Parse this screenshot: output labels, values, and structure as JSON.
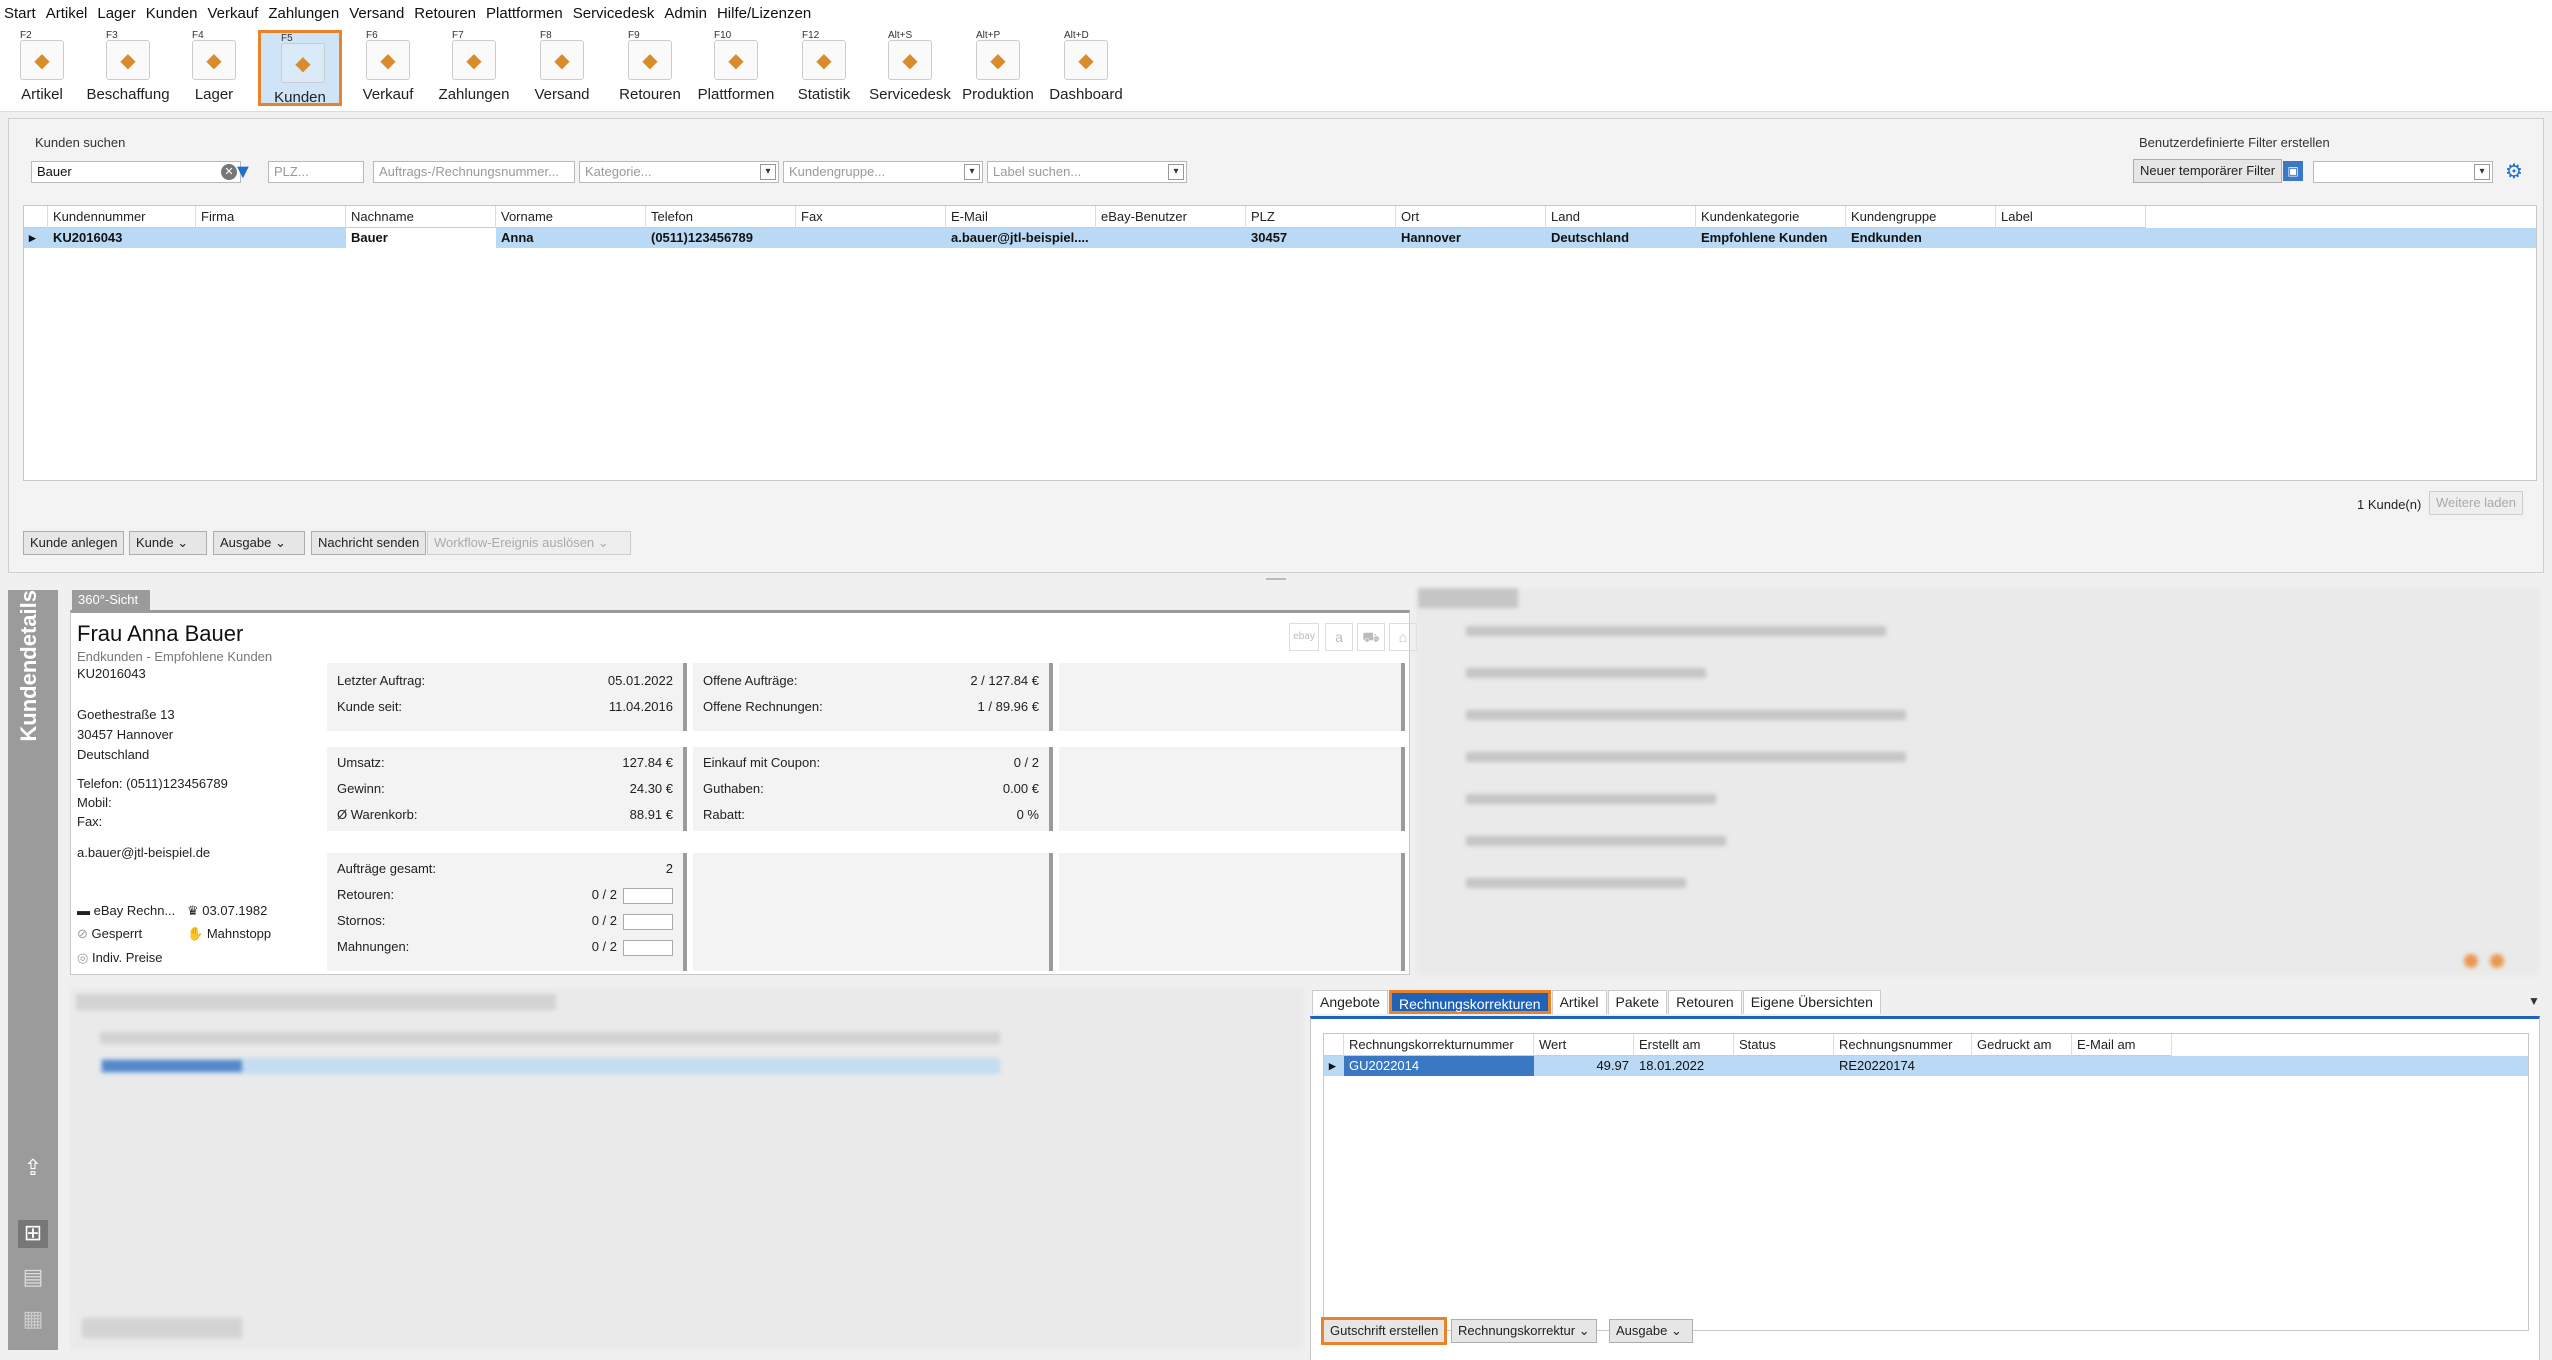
{
  "menu": [
    "Start",
    "Artikel",
    "Lager",
    "Kunden",
    "Verkauf",
    "Zahlungen",
    "Versand",
    "Retouren",
    "Plattformen",
    "Servicedesk",
    "Admin",
    "Hilfe/Lizenzen"
  ],
  "ribbon": [
    {
      "key": "F2",
      "label": "Artikel",
      "icon": "tag-icon"
    },
    {
      "key": "F3",
      "label": "Beschaffung",
      "icon": "box-star-icon"
    },
    {
      "key": "F4",
      "label": "Lager",
      "icon": "warehouse-icon"
    },
    {
      "key": "F5",
      "label": "Kunden",
      "icon": "customer-icon",
      "active": true
    },
    {
      "key": "F6",
      "label": "Verkauf",
      "icon": "cart-icon"
    },
    {
      "key": "F7",
      "label": "Zahlungen",
      "icon": "payment-icon"
    },
    {
      "key": "F8",
      "label": "Versand",
      "icon": "shipping-icon"
    },
    {
      "key": "F9",
      "label": "Retouren",
      "icon": "return-icon"
    },
    {
      "key": "F10",
      "label": "Plattformen",
      "icon": "platform-icon"
    },
    {
      "key": "F12",
      "label": "Statistik",
      "icon": "chart-icon"
    },
    {
      "key": "Alt+S",
      "label": "Servicedesk",
      "icon": "servicedesk-icon"
    },
    {
      "key": "Alt+P",
      "label": "Produktion",
      "icon": "production-icon"
    },
    {
      "key": "Alt+D",
      "label": "Dashboard",
      "icon": "dashboard-icon"
    }
  ],
  "search": {
    "group_title": "Kunden suchen",
    "value": "Bauer",
    "plz_placeholder": "PLZ...",
    "order_placeholder": "Auftrags-/Rechnungsnummer...",
    "category_placeholder": "Kategorie...",
    "group_placeholder": "Kundengruppe...",
    "label_placeholder": "Label suchen..."
  },
  "custom_filter": {
    "title": "Benutzerdefinierte Filter erstellen",
    "button": "Neuer temporärer Filter"
  },
  "customer_grid": {
    "columns": [
      "Kundennummer",
      "Firma",
      "Nachname",
      "Vorname",
      "Telefon",
      "Fax",
      "E-Mail",
      "eBay-Benutzer",
      "PLZ",
      "Ort",
      "Land",
      "Kundenkategorie",
      "Kundengruppe",
      "Label"
    ],
    "row": [
      "KU2016043",
      "",
      "Bauer",
      "Anna",
      "(0511)123456789",
      "",
      "a.bauer@jtl-beispiel....",
      "",
      "30457",
      "Hannover",
      "Deutschland",
      "Empfohlene Kunden",
      "Endkunden",
      ""
    ]
  },
  "count_text": "1 Kunde(n)",
  "more_button": "Weitere laden",
  "actions": {
    "add": "Kunde anlegen",
    "customer": "Kunde",
    "output": "Ausgabe",
    "message": "Nachricht senden",
    "workflow": "Workflow-Ereignis auslösen"
  },
  "sidebar_title": "Kundendetails",
  "view_tab": "360°-Sicht",
  "customer": {
    "name": "Frau Anna Bauer",
    "groups": "Endkunden - Empfohlene Kunden",
    "number": "KU2016043",
    "street": "Goethestraße 13",
    "city": "30457 Hannover",
    "country": "Deutschland",
    "phone": "Telefon: (0511)123456789",
    "mobile": "Mobil:",
    "fax": "Fax:",
    "email": "a.bauer@jtl-beispiel.de",
    "payment": "eBay Rechn...",
    "birthday": "03.07.1982",
    "locked": "Gesperrt",
    "dunning": "Mahnstopp",
    "prices": "Indiv. Preise"
  },
  "stats": {
    "last_order_l": "Letzter Auftrag:",
    "last_order_v": "05.01.2022",
    "since_l": "Kunde seit:",
    "since_v": "11.04.2016",
    "open_orders_l": "Offene Aufträge:",
    "open_orders_v": "2 / 127.84 €",
    "open_inv_l": "Offene Rechnungen:",
    "open_inv_v": "1 / 89.96 €",
    "revenue_l": "Umsatz:",
    "revenue_v": "127.84 €",
    "profit_l": "Gewinn:",
    "profit_v": "24.30 €",
    "cart_l": "Ø Warenkorb:",
    "cart_v": "88.91 €",
    "coupon_l": "Einkauf mit Coupon:",
    "coupon_v": "0 / 2",
    "credit_l": "Guthaben:",
    "credit_v": "0.00 €",
    "discount_l": "Rabatt:",
    "discount_v": "0 %",
    "orders_total_l": "Aufträge gesamt:",
    "orders_total_v": "2",
    "returns_l": "Retouren:",
    "returns_v": "0 / 2",
    "cancel_l": "Stornos:",
    "cancel_v": "0 / 2",
    "dunnings_l": "Mahnungen:",
    "dunnings_v": "0 / 2"
  },
  "right_tabs": [
    "Angebote",
    "Rechnungskorrekturen",
    "Artikel",
    "Pakete",
    "Retouren",
    "Eigene Übersichten"
  ],
  "correction_grid": {
    "columns": [
      "Rechnungskorrekturnummer",
      "Wert",
      "Erstellt am",
      "Status",
      "Rechnungsnummer",
      "Gedruckt am",
      "E-Mail am"
    ],
    "row": [
      "GU2022014",
      "49.97",
      "18.01.2022",
      "",
      "RE20220174",
      "",
      ""
    ]
  },
  "bottom_buttons": {
    "credit": "Gutschrift erstellen",
    "correction": "Rechnungskorrektur",
    "output": "Ausgabe"
  },
  "colors": {
    "accent": "#e8832a",
    "selection": "#b9d9f4",
    "tab_active": "#1f63b8",
    "sidebar": "#9b9b9b"
  }
}
